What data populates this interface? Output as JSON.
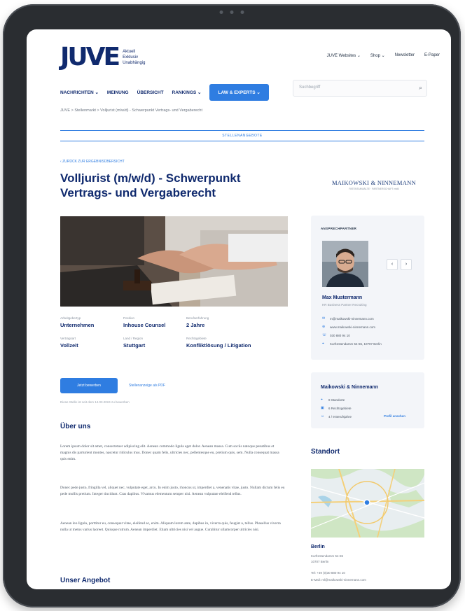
{
  "header": {
    "logo_mark": "JUVE",
    "logo_sub": [
      "Aktuell",
      "Exklusiv",
      "Unabhängig"
    ],
    "top_links": [
      "JUVE Websites ⌄",
      "Shop ⌄",
      "Newsletter",
      "E-Paper"
    ],
    "nav": [
      "NACHRICHTEN ⌄",
      "MEINUNG",
      "ÜBERSICHT",
      "RANKINGS ⌄"
    ],
    "cta": "LAW & EXPERTS ⌄",
    "search_placeholder": "Suchbegriff"
  },
  "breadcrumb": "JUVE > Stellenmarkt > Volljurist (m/w/d) - Schwerpunkt Vertrags- und Vergaberecht",
  "jobbar": "STELLENANGEBOTE",
  "back_link": "ZURÜCK ZUR ERGEBNISÜBERSICHT",
  "job_title": "Volljurist (m/w/d) - Schwerpunkt Vertrags- und Vergaberecht",
  "facts": [
    {
      "key": "Arbeitgebertyp",
      "value": "Unternehmen"
    },
    {
      "key": "Position",
      "value": "Inhouse Counsel"
    },
    {
      "key": "Berufserfahrung",
      "value": "2 Jahre"
    },
    {
      "key": "Vertragsart",
      "value": "Vollzeit"
    },
    {
      "key": "Land / Region",
      "value": "Stuttgart"
    },
    {
      "key": "Rechtsgebiete",
      "value": "Konfliktlösung / Litigation"
    }
  ],
  "apply_button": "Jetzt bewerben",
  "pdf_link": "Stellenanzeige als PDF",
  "posted_note": "Diese Stelle ist seit dem 14.03.2024 zu bewerben",
  "about_heading": "Über uns",
  "paragraphs": [
    "Lorem ipsum dolor sit amet, consectetuer adipiscing elit. Aenean commodo ligula eget dolor. Aenean massa. Cum sociis natoque penatibus et magnis dis parturient montes, nascetur ridiculus mus. Donec quam felis, ultricies nec, pellentesque eu, pretium quis, sem. Nulla consequat massa quis enim.",
    "Donec pede justo, fringilla vel, aliquet nec, vulputate eget, arcu. In enim justo, rhoncus ut, imperdiet a, venenatis vitae, justo. Nullam dictum felis eu pede mollis pretium. Integer tincidunt. Cras dapibus. Vivamus elementum semper nisi. Aenean vulputate eleifend tellus.",
    "Aenean leo ligula, porttitor eu, consequat vitae, eleifend ac, enim. Aliquam lorem ante, dapibus in, viverra quis, feugiat a, tellus. Phasellus viverra nulla ut metus varius laoreet. Quisque rutrum. Aenean imperdiet. Etiam ultricies nisi vel augue. Curabitur ullamcorper ultricies nisi."
  ],
  "offer_heading": "Unser Angebot",
  "sidebar": {
    "company_logo": "MAIKOWSKI & NINNEMANN",
    "company_logo_sub": "PATENTANWÄLTE · PARTNERSCHAFT mbB",
    "contact_label": "ANSPRECHPARTNER",
    "contact_name": "Max Mustermann",
    "contact_role": "HR Business Partner Recruiting",
    "contact_rows": [
      {
        "icon": "mail-icon",
        "text": "m@maikowski-ninnemann.com"
      },
      {
        "icon": "web-icon",
        "text": "www.maikowski-ninnemann.com"
      },
      {
        "icon": "phone-icon",
        "text": "030 880 94 10"
      },
      {
        "icon": "location-icon",
        "text": "Kurfürstendamm 54-55, 10707 Berlin"
      }
    ],
    "company_name": "Maikowski & Ninnemann",
    "company_facts": [
      "8 Standorte",
      "6 Rechtsgebiete",
      "4 / 9 Berufsjahre"
    ],
    "profile_link": "Profil ansehen",
    "location_heading": "Standort",
    "location_city": "Berlin",
    "address_lines": [
      "Kurfürstendamm 54-55",
      "10707 Berlin"
    ],
    "contact_lines": [
      "Tel: +49 (0)30 880 94 10",
      "E-Mail: ml@maikowski-ninnemann.com"
    ]
  },
  "colors": {
    "brand": "#102a6e",
    "accent": "#2f7de1"
  }
}
